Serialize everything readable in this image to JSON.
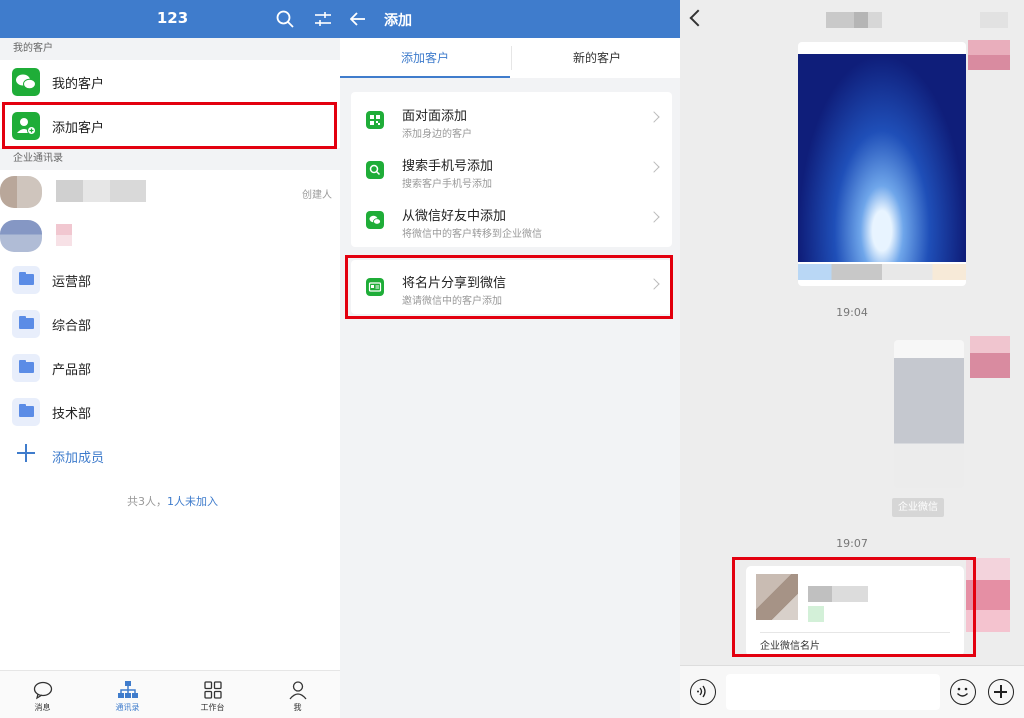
{
  "contacts": {
    "title": "123",
    "section_my_customers": "我的客户",
    "my_customers_label": "我的客户",
    "add_customer_label": "添加客户",
    "section_directory": "企业通讯录",
    "creator_tag": "创建人",
    "departments": [
      "运营部",
      "综合部",
      "产品部",
      "技术部"
    ],
    "add_member_label": "添加成员",
    "count_text": "共3人，",
    "not_joined_link": "1人未加入",
    "tabs": [
      "消息",
      "通讯录",
      "工作台",
      "我"
    ],
    "active_tab": "通讯录"
  },
  "add_page": {
    "title": "添加",
    "tabs": [
      "添加客户",
      "新的客户"
    ],
    "items": [
      {
        "icon": "qrcode-icon",
        "title": "面对面添加",
        "subtitle": "添加身边的客户"
      },
      {
        "icon": "search-icon",
        "title": "搜索手机号添加",
        "subtitle": "搜索客户手机号添加"
      },
      {
        "icon": "wechat-icon",
        "title": "从微信好友中添加",
        "subtitle": "将微信中的客户转移到企业微信"
      }
    ],
    "share_item": {
      "icon": "business-card-icon",
      "title": "将名片分享到微信",
      "subtitle": "邀请微信中的客户添加"
    }
  },
  "chat": {
    "time_1": "19:04",
    "time_2": "19:07",
    "wework_label": "企业微信",
    "card_caption": "企业微信名片"
  },
  "colors": {
    "brand_blue": "#3f7ccc",
    "green": "#1fad38",
    "highlight_red": "#e3000f"
  }
}
